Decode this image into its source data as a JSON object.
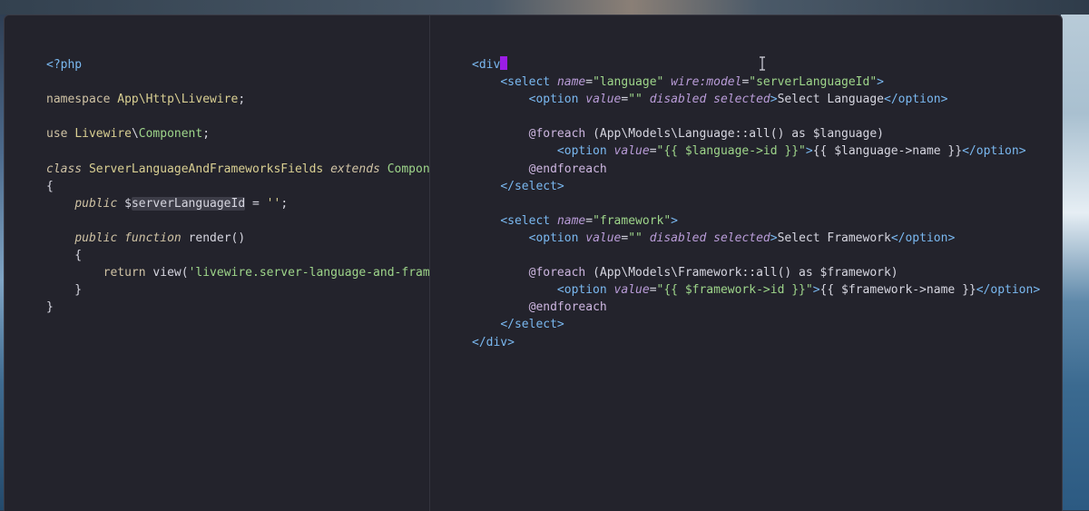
{
  "editor": {
    "left_pane": {
      "lines": [
        [
          {
            "c": "t-tag",
            "t": "<?php"
          }
        ],
        [],
        [
          {
            "c": "t-kw",
            "t": "namespace "
          },
          {
            "c": "t-ns",
            "t": "App\\Http\\Livewire"
          },
          {
            "c": "t-plain",
            "t": ";"
          }
        ],
        [],
        [
          {
            "c": "t-kw",
            "t": "use "
          },
          {
            "c": "t-ns",
            "t": "Livewire"
          },
          {
            "c": "t-plain",
            "t": "\\"
          },
          {
            "c": "t-green",
            "t": "Component"
          },
          {
            "c": "t-plain",
            "t": ";"
          }
        ],
        [],
        [
          {
            "c": "t-kwi",
            "t": "class "
          },
          {
            "c": "t-ns",
            "t": "ServerLanguageAndFrameworksFields "
          },
          {
            "c": "t-kwi",
            "t": "extends "
          },
          {
            "c": "t-green",
            "t": "Component"
          }
        ],
        [
          {
            "c": "t-plain",
            "t": "{"
          }
        ],
        [
          {
            "c": "t-plain",
            "t": "    "
          },
          {
            "c": "t-kwi",
            "t": "public "
          },
          {
            "c": "t-plain",
            "t": "$"
          },
          {
            "c": "t-plain t-var-hl",
            "t": "serverLanguageId"
          },
          {
            "c": "t-plain",
            "t": " = "
          },
          {
            "c": "t-str",
            "t": "''"
          },
          {
            "c": "t-plain",
            "t": ";"
          }
        ],
        [],
        [
          {
            "c": "t-plain",
            "t": "    "
          },
          {
            "c": "t-kwi",
            "t": "public "
          },
          {
            "c": "t-kwi",
            "t": "function "
          },
          {
            "c": "t-plain",
            "t": "render()"
          }
        ],
        [
          {
            "c": "t-plain",
            "t": "    {"
          }
        ],
        [
          {
            "c": "t-plain",
            "t": "        "
          },
          {
            "c": "t-kw",
            "t": "return "
          },
          {
            "c": "t-plain",
            "t": "view("
          },
          {
            "c": "t-green",
            "t": "'livewire.server-language-and-frameworks-fields'"
          },
          {
            "c": "t-plain",
            "t": ");"
          }
        ],
        [
          {
            "c": "t-plain",
            "t": "    }"
          }
        ],
        [
          {
            "c": "t-plain",
            "t": "}"
          }
        ]
      ]
    },
    "right_pane": {
      "lines": [
        [
          {
            "c": "t-tag",
            "t": "<div"
          },
          {
            "c": "cursor",
            "t": ""
          }
        ],
        [
          {
            "c": "t-plain",
            "t": "    "
          },
          {
            "c": "t-tag",
            "t": "<select "
          },
          {
            "c": "t-attr",
            "t": "name"
          },
          {
            "c": "t-plain",
            "t": "="
          },
          {
            "c": "t-green",
            "t": "\"language\" "
          },
          {
            "c": "t-attr",
            "t": "wire:model"
          },
          {
            "c": "t-plain",
            "t": "="
          },
          {
            "c": "t-green",
            "t": "\"serverLanguageId\""
          },
          {
            "c": "t-tag",
            "t": ">"
          }
        ],
        [
          {
            "c": "t-plain",
            "t": "        "
          },
          {
            "c": "t-tag",
            "t": "<option "
          },
          {
            "c": "t-attr",
            "t": "value"
          },
          {
            "c": "t-plain",
            "t": "="
          },
          {
            "c": "t-green",
            "t": "\"\" "
          },
          {
            "c": "t-attr",
            "t": "disabled selected"
          },
          {
            "c": "t-tag",
            "t": ">"
          },
          {
            "c": "t-plain",
            "t": "Select Language"
          },
          {
            "c": "t-tag",
            "t": "</option>"
          }
        ],
        [],
        [
          {
            "c": "t-plain",
            "t": "        "
          },
          {
            "c": "t-dir",
            "t": "@foreach "
          },
          {
            "c": "t-plain",
            "t": "(App\\Models\\Language::all() as $language)"
          }
        ],
        [
          {
            "c": "t-plain",
            "t": "            "
          },
          {
            "c": "t-tag",
            "t": "<option "
          },
          {
            "c": "t-attr",
            "t": "value"
          },
          {
            "c": "t-plain",
            "t": "="
          },
          {
            "c": "t-green",
            "t": "\"{{ $language->id }}\""
          },
          {
            "c": "t-tag",
            "t": ">"
          },
          {
            "c": "t-plain",
            "t": "{{ $language->name }}"
          },
          {
            "c": "t-tag",
            "t": "</option>"
          }
        ],
        [
          {
            "c": "t-plain",
            "t": "        "
          },
          {
            "c": "t-dir",
            "t": "@endforeach"
          }
        ],
        [
          {
            "c": "t-plain",
            "t": "    "
          },
          {
            "c": "t-tag",
            "t": "</select>"
          }
        ],
        [],
        [
          {
            "c": "t-plain",
            "t": "    "
          },
          {
            "c": "t-tag",
            "t": "<select "
          },
          {
            "c": "t-attr",
            "t": "name"
          },
          {
            "c": "t-plain",
            "t": "="
          },
          {
            "c": "t-green",
            "t": "\"framework\""
          },
          {
            "c": "t-tag",
            "t": ">"
          }
        ],
        [
          {
            "c": "t-plain",
            "t": "        "
          },
          {
            "c": "t-tag",
            "t": "<option "
          },
          {
            "c": "t-attr",
            "t": "value"
          },
          {
            "c": "t-plain",
            "t": "="
          },
          {
            "c": "t-green",
            "t": "\"\" "
          },
          {
            "c": "t-attr",
            "t": "disabled selected"
          },
          {
            "c": "t-tag",
            "t": ">"
          },
          {
            "c": "t-plain",
            "t": "Select Framework"
          },
          {
            "c": "t-tag",
            "t": "</option>"
          }
        ],
        [],
        [
          {
            "c": "t-plain",
            "t": "        "
          },
          {
            "c": "t-dir",
            "t": "@foreach "
          },
          {
            "c": "t-plain",
            "t": "(App\\Models\\Framework::all() as $framework)"
          }
        ],
        [
          {
            "c": "t-plain",
            "t": "            "
          },
          {
            "c": "t-tag",
            "t": "<option "
          },
          {
            "c": "t-attr",
            "t": "value"
          },
          {
            "c": "t-plain",
            "t": "="
          },
          {
            "c": "t-green",
            "t": "\"{{ $framework->id }}\""
          },
          {
            "c": "t-tag",
            "t": ">"
          },
          {
            "c": "t-plain",
            "t": "{{ $framework->name }}"
          },
          {
            "c": "t-tag",
            "t": "</option>"
          }
        ],
        [
          {
            "c": "t-plain",
            "t": "        "
          },
          {
            "c": "t-dir",
            "t": "@endforeach"
          }
        ],
        [
          {
            "c": "t-plain",
            "t": "    "
          },
          {
            "c": "t-tag",
            "t": "</select>"
          }
        ],
        [
          {
            "c": "t-tag",
            "t": "</div>"
          }
        ]
      ]
    }
  },
  "colors": {
    "editor_background": "#23232c",
    "cursor": "#9b1de6"
  }
}
